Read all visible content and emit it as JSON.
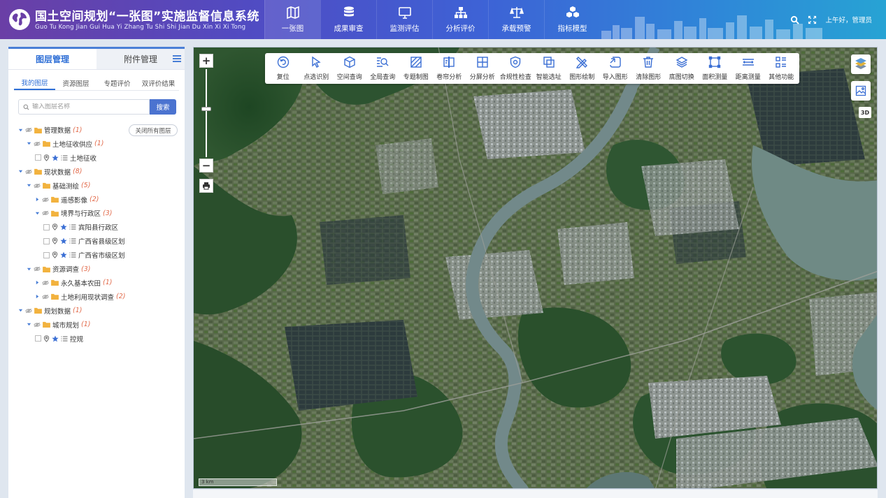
{
  "header": {
    "title": "国土空间规划“一张图”实施监督信息系统",
    "subtitle": "Guo Tu Kong Jian Gui Hua Yi Zhang Tu Shi Shi Jian Du Xin Xi Xi Tong",
    "greeting": "上午好，管理员",
    "nav": [
      {
        "label": "一张图",
        "icon": "map-icon"
      },
      {
        "label": "成果审查",
        "icon": "database-icon"
      },
      {
        "label": "监测评估",
        "icon": "monitor-icon"
      },
      {
        "label": "分析评价",
        "icon": "hierarchy-icon"
      },
      {
        "label": "承载预警",
        "icon": "scale-icon"
      },
      {
        "label": "指标模型",
        "icon": "cubes-icon"
      }
    ]
  },
  "left_panel": {
    "tabs": [
      "图层管理",
      "附件管理"
    ],
    "sub_tabs": [
      "我的图层",
      "资源图层",
      "专题评价",
      "双评价结果"
    ],
    "search_placeholder": "输入图层名称",
    "search_button": "搜索",
    "close_all": "关闭所有图层",
    "tree": [
      {
        "label": "管理数据",
        "count": "(1)",
        "level": 0,
        "kind": "folder",
        "expanded": true
      },
      {
        "label": "土地征收供应",
        "count": "(1)",
        "level": 1,
        "kind": "folder",
        "expanded": true
      },
      {
        "label": "土地征收",
        "count": "",
        "level": 2,
        "kind": "layer"
      },
      {
        "label": "现状数据",
        "count": "(8)",
        "level": 0,
        "kind": "folder",
        "expanded": true
      },
      {
        "label": "基础测绘",
        "count": "(5)",
        "level": 1,
        "kind": "folder",
        "expanded": true
      },
      {
        "label": "遥感影像",
        "count": "(2)",
        "level": 2,
        "kind": "folder",
        "expanded": false
      },
      {
        "label": "境界与行政区",
        "count": "(3)",
        "level": 2,
        "kind": "folder",
        "expanded": true
      },
      {
        "label": "宾阳县行政区",
        "count": "",
        "level": 3,
        "kind": "layer"
      },
      {
        "label": "广西省县级区划",
        "count": "",
        "level": 3,
        "kind": "layer"
      },
      {
        "label": "广西省市级区划",
        "count": "",
        "level": 3,
        "kind": "layer"
      },
      {
        "label": "资源调查",
        "count": "(3)",
        "level": 1,
        "kind": "folder",
        "expanded": true
      },
      {
        "label": "永久基本农田",
        "count": "(1)",
        "level": 2,
        "kind": "folder",
        "expanded": false
      },
      {
        "label": "土地利用现状调查",
        "count": "(2)",
        "level": 2,
        "kind": "folder",
        "expanded": false
      },
      {
        "label": "规划数据",
        "count": "(1)",
        "level": 0,
        "kind": "folder",
        "expanded": true
      },
      {
        "label": "城市规划",
        "count": "(1)",
        "level": 1,
        "kind": "folder",
        "expanded": true
      },
      {
        "label": "控规",
        "count": "",
        "level": 2,
        "kind": "layer"
      }
    ]
  },
  "toolbar": [
    {
      "label": "复位",
      "icon": "reset-icon"
    },
    {
      "label": "点选识别",
      "icon": "pointer-icon"
    },
    {
      "label": "空间查询",
      "icon": "cube-icon"
    },
    {
      "label": "全局查询",
      "icon": "list-search-icon"
    },
    {
      "label": "专题制图",
      "icon": "hatch-icon"
    },
    {
      "label": "卷帘分析",
      "icon": "swipe-icon"
    },
    {
      "label": "分屏分析",
      "icon": "split-screen-icon"
    },
    {
      "label": "合规性检查",
      "icon": "shield-check-icon"
    },
    {
      "label": "智能选址",
      "icon": "overlap-icon"
    },
    {
      "label": "图形绘制",
      "icon": "pencil-ruler-icon"
    },
    {
      "label": "导入图形",
      "icon": "import-shape-icon"
    },
    {
      "label": "清除图形",
      "icon": "trash-icon"
    },
    {
      "label": "底图切换",
      "icon": "layers-icon"
    },
    {
      "label": "面积测量",
      "icon": "area-measure-icon"
    },
    {
      "label": "距离测量",
      "icon": "distance-measure-icon"
    },
    {
      "label": "其他功能",
      "icon": "more-functions-icon"
    }
  ],
  "map": {
    "zoom_in": "+",
    "zoom_out": "−",
    "scale_label": "3 km",
    "mode_3d": "3D"
  }
}
